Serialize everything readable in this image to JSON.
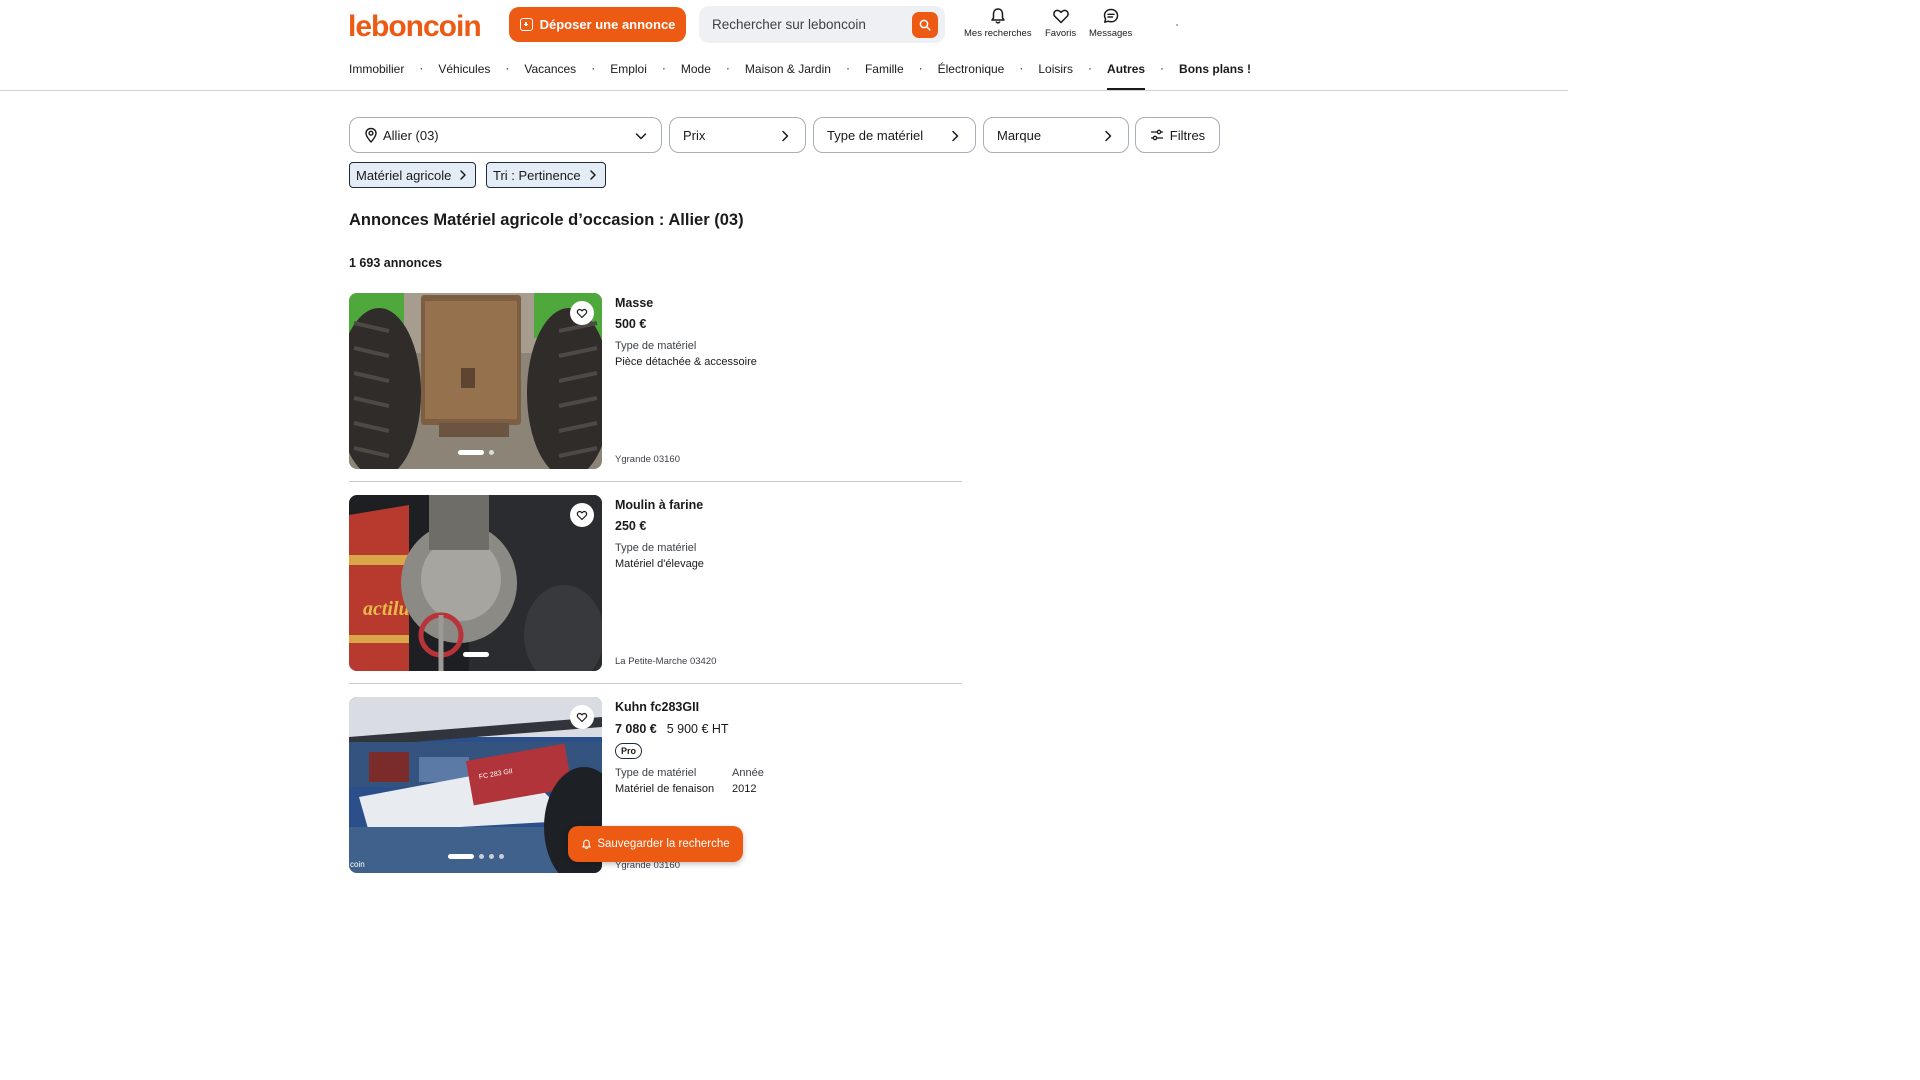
{
  "brand": {
    "logo_text": "leboncoin",
    "accent": "#ec5a13"
  },
  "header": {
    "deposit_label": "Déposer une annonce",
    "search_placeholder": "Rechercher sur leboncoin",
    "icons": [
      {
        "name": "bell-icon",
        "label": "Mes recherches"
      },
      {
        "name": "heart-icon",
        "label": "Favoris"
      },
      {
        "name": "chat-icon",
        "label": "Messages"
      }
    ]
  },
  "categories": [
    "Immobilier",
    "Véhicules",
    "Vacances",
    "Emploi",
    "Mode",
    "Maison & Jardin",
    "Famille",
    "Électronique",
    "Loisirs",
    "Autres",
    "Bons plans !"
  ],
  "active_category": "Autres",
  "filters": {
    "location": "Allier (03)",
    "price": "Prix",
    "type": "Type de matériel",
    "brand": "Marque",
    "more": "Filtres"
  },
  "chips": {
    "category": "Matériel agricole",
    "sort": "Tri : Pertinence"
  },
  "page_title": "Annonces Matériel agricole d’occasion : Allier (03)",
  "count": "1 693 annonces",
  "listings": [
    {
      "title": "Masse",
      "price": "500 €",
      "attr1_key": "Type de matériel",
      "attr1_val": "Pièce détachée & accessoire",
      "location": "Ygrande 03160",
      "photo_dots": 2
    },
    {
      "title": "Moulin à farine",
      "price": "250 €",
      "attr1_key": "Type de matériel",
      "attr1_val": "Matériel d'élevage",
      "location": "La Petite-Marche 03420",
      "photo_dots": 1
    },
    {
      "title": "Kuhn fc283GII",
      "price": "7 080 €",
      "price_ht": "5 900 € HT",
      "badge": "Pro",
      "attr1_key": "Type de matériel",
      "attr1_val": "Matériel de fenaison",
      "attr2_key": "Année",
      "attr2_val": "2012",
      "location": "Ygrande 03160",
      "photo_dots": 4
    }
  ],
  "save_search_label": "Sauvegarder la recherche"
}
